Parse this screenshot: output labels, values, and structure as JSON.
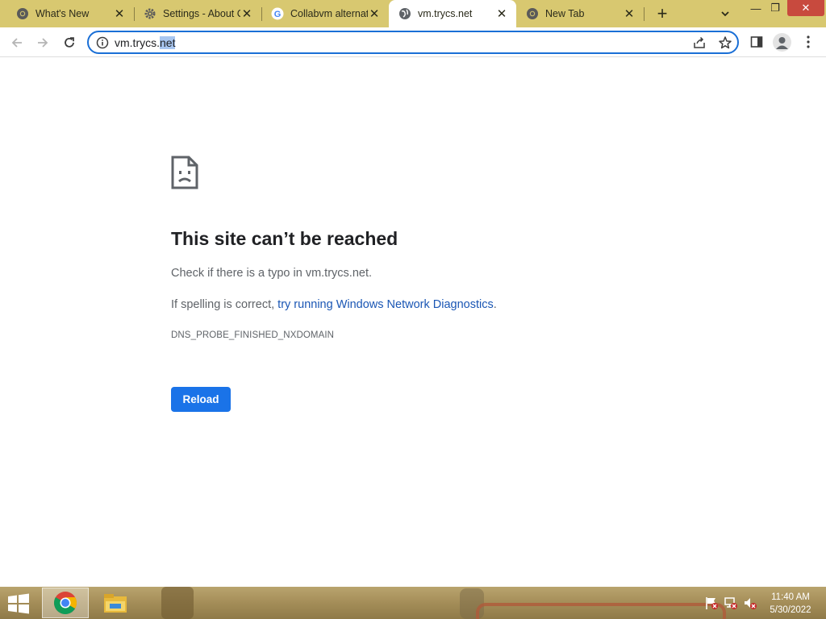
{
  "browser": {
    "tabs": [
      {
        "title": "What's New",
        "icon": "chrome-icon",
        "active": false
      },
      {
        "title": "Settings - About C",
        "icon": "settings-gear-icon",
        "active": false
      },
      {
        "title": "Collabvm alternati",
        "icon": "google-icon",
        "active": false
      },
      {
        "title": "vm.trycs.net",
        "icon": "globe-icon",
        "active": true
      },
      {
        "title": "New Tab",
        "icon": "chrome-icon",
        "active": false
      }
    ],
    "new_tab_label": "+",
    "close_glyph": "✕",
    "window_controls": {
      "minimize": "—",
      "restore": "❐",
      "close": "✕"
    },
    "address_bar": {
      "url_plain": "vm.trycs.",
      "url_selected": "net"
    }
  },
  "page": {
    "title": "This site can’t be reached",
    "line1": "Check if there is a typo in vm.trycs.net.",
    "line2_prefix": "If spelling is correct, ",
    "line2_link": "try running Windows Network Diagnostics",
    "line2_suffix": ".",
    "error_code": "DNS_PROBE_FINISHED_NXDOMAIN",
    "reload_label": "Reload"
  },
  "taskbar": {
    "apps": [
      "chrome-icon",
      "file-explorer-icon"
    ],
    "tray_icons": [
      "action-center-flag-icon",
      "network-icon",
      "volume-muted-icon"
    ],
    "clock_time": "11:40 AM",
    "clock_date": "5/30/2022"
  },
  "colors": {
    "tabstrip": "#d8c870",
    "omnibox_focus": "#1a6fd6",
    "link": "#1a56b4",
    "reload_button": "#1a73e8"
  }
}
